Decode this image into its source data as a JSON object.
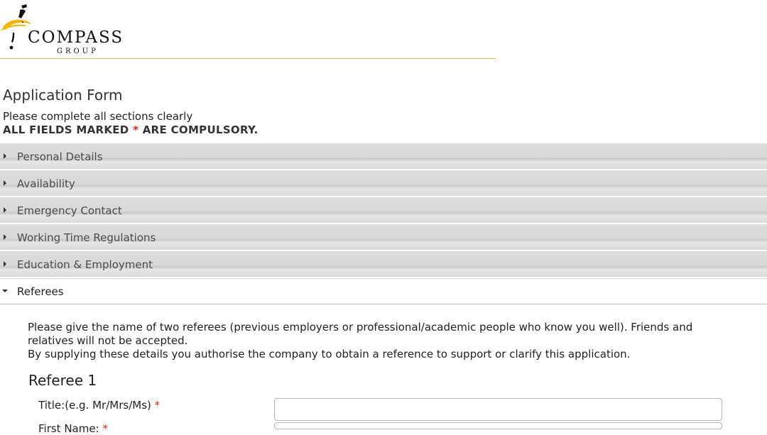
{
  "logo": {
    "word": "COMPASS",
    "sub": "GROUP",
    "accent_color": "#f2b705"
  },
  "page": {
    "title": "Application Form",
    "intro": "Please complete all sections clearly",
    "compulsory_prefix": "ALL FIELDS MARKED ",
    "compulsory_marker": "*",
    "compulsory_suffix": " ARE COMPULSORY."
  },
  "sections": [
    {
      "label": "Personal Details",
      "expanded": false
    },
    {
      "label": "Availability",
      "expanded": false
    },
    {
      "label": "Emergency Contact",
      "expanded": false
    },
    {
      "label": "Working Time Regulations",
      "expanded": false
    },
    {
      "label": "Education & Employment",
      "expanded": false
    },
    {
      "label": "Referees",
      "expanded": true
    }
  ],
  "referees": {
    "instruction_1": "Please give the name of two referees (previous employers or professional/academic people who know you well).   Friends and relatives will not be accepted.",
    "instruction_2": "By supplying these details you authorise the company to obtain a reference to support or clarify this application.",
    "heading": "Referee 1",
    "fields": [
      {
        "label": "Title:(e.g. Mr/Mrs/Ms)",
        "required_marker": "*",
        "value": ""
      },
      {
        "label": "First Name:",
        "required_marker": "*",
        "value": ""
      }
    ]
  },
  "colors": {
    "required": "#d9261c",
    "section_bar": "#dcdcdc",
    "header_rule": "#e3b23c"
  },
  "icons": {
    "collapsed": "caret-right-icon",
    "expanded": "caret-down-icon"
  }
}
